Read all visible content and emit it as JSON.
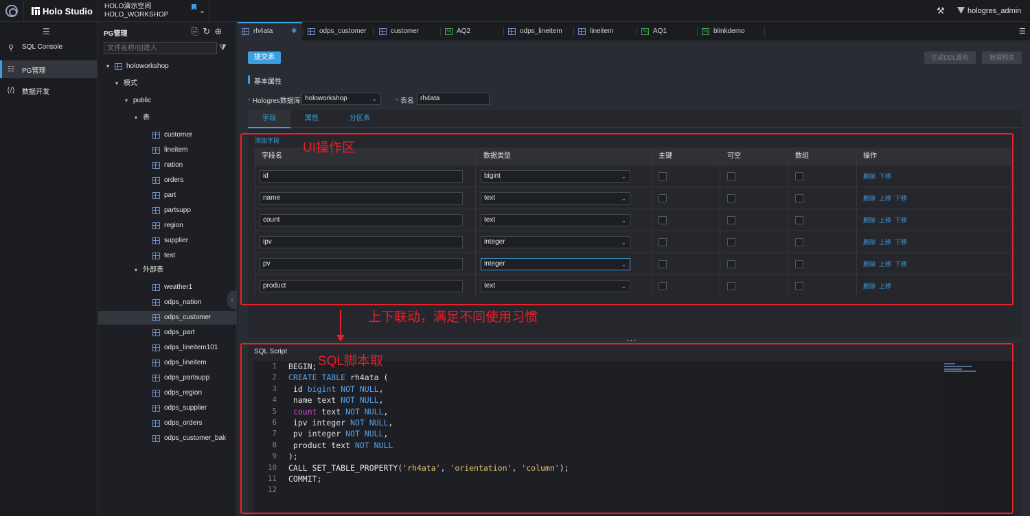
{
  "app": {
    "brand": "Holo Studio",
    "workspace_line1": "HOLO演示空间",
    "workspace_line2": "HOLO_WORKSHOP",
    "user": "hologres_admin"
  },
  "leftnav": {
    "items": [
      {
        "label": "SQL Console",
        "icon": "search-icon"
      },
      {
        "label": "PG管理",
        "icon": "pg-manage-icon"
      },
      {
        "label": "数据开发",
        "icon": "code-icon"
      }
    ]
  },
  "tree": {
    "title": "PG管理",
    "search_placeholder": "文件名称/创建人",
    "db": "holoworkshop",
    "schema_group": "模式",
    "schema": "public",
    "tables_group": "表",
    "tables": [
      "customer",
      "lineitem",
      "nation",
      "orders",
      "part",
      "partsupp",
      "region",
      "supplier",
      "test"
    ],
    "foreign_group": "外部表",
    "foreign_tables": [
      "weather1",
      "odps_nation",
      "odps_customer",
      "odps_part",
      "odps_lineitem101",
      "odps_lineitem",
      "odps_partsupp",
      "odps_region",
      "odps_supplier",
      "odps_orders",
      "odps_customer_bak"
    ]
  },
  "tabs": [
    {
      "label": "rh4ata",
      "icon": "table-icon"
    },
    {
      "label": "odps_customer",
      "icon": "table-icon"
    },
    {
      "label": "customer",
      "icon": "table-icon"
    },
    {
      "label": "AQ2",
      "icon": "sql-icon"
    },
    {
      "label": "odps_lineitem",
      "icon": "table-icon"
    },
    {
      "label": "lineitem",
      "icon": "table-icon"
    },
    {
      "label": "AQ1",
      "icon": "sql-icon"
    },
    {
      "label": "blinkdemo",
      "icon": "sql-icon"
    }
  ],
  "toolbar": {
    "submit": "提交表",
    "gen_ddl": "生成DDL语句",
    "preview": "数据预览"
  },
  "form": {
    "section": "基本属性",
    "db_label": "Hologres数据库",
    "db_value": "holoworkshop",
    "table_label": "表名",
    "table_value": "rh4ata"
  },
  "subtabs": [
    "字段",
    "属性",
    "分区表"
  ],
  "grid": {
    "add_field": "添加字段",
    "headers": [
      "字段名",
      "数据类型",
      "主键",
      "可空",
      "数组",
      "操作"
    ],
    "rows": [
      {
        "name": "id",
        "type": "bigint",
        "ops": [
          "删除",
          "下移"
        ]
      },
      {
        "name": "name",
        "type": "text",
        "ops": [
          "删除",
          "上移",
          "下移"
        ]
      },
      {
        "name": "count",
        "type": "text",
        "ops": [
          "删除",
          "上移",
          "下移"
        ]
      },
      {
        "name": "ipv",
        "type": "integer",
        "ops": [
          "删除",
          "上移",
          "下移"
        ]
      },
      {
        "name": "pv",
        "type": "integer",
        "ops": [
          "删除",
          "上移",
          "下移"
        ]
      },
      {
        "name": "product",
        "type": "text",
        "ops": [
          "删除",
          "上移"
        ]
      }
    ]
  },
  "annotations": {
    "ui_area": "UI操作区",
    "link": "上下联动，满足不同使用习惯",
    "sql_area": "SQL脚本取"
  },
  "sql": {
    "title": "SQL Script",
    "lines": [
      "BEGIN;",
      "CREATE TABLE rh4ata (",
      " id bigint NOT NULL,",
      " name text NOT NULL,",
      " count text NOT NULL,",
      " ipv integer NOT NULL,",
      " pv integer NOT NULL,",
      " product text NOT NULL",
      ");",
      "CALL SET_TABLE_PROPERTY('rh4ata', 'orientation', 'column');",
      "COMMIT;",
      ""
    ]
  },
  "colors": {
    "accent": "#3c9fe0",
    "annotation": "#e8202a",
    "keyword": "#5aa0e8",
    "function": "#d04ad0",
    "string": "#e8c36a"
  }
}
